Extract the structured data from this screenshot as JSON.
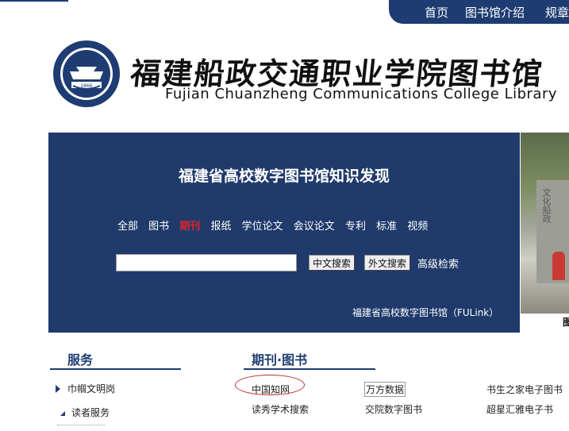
{
  "top_nav": {
    "items": [
      "首页",
      "图书馆介绍",
      "规章"
    ]
  },
  "header": {
    "logo_year": "1866",
    "title_cn": "福建船政交通职业学院图书馆",
    "title_en": "Fujian Chuanzheng Communications College Library"
  },
  "search_panel": {
    "title": "福建省高校数字图书馆知识发现",
    "categories": [
      "全部",
      "图书",
      "期刊",
      "报纸",
      "学位论文",
      "会议论文",
      "专利",
      "标准",
      "视频"
    ],
    "active_category": "期刊",
    "input_value": "",
    "cn_search_label": "中文搜索",
    "foreign_search_label": "外文搜索",
    "advanced_label": "高级检索",
    "footer": "福建省高校数字图书馆（FULink）"
  },
  "photo": {
    "stone_text": "文化船政",
    "caption": "图"
  },
  "services": {
    "title": "服务",
    "items": [
      "巾帼文明岗",
      "读者服务"
    ]
  },
  "journals": {
    "title": "期刊·图书",
    "rows": [
      [
        "中国知网",
        "万方数据",
        "书生之家电子图书"
      ],
      [
        "读秀学术搜索",
        "交院数字图书",
        "超星汇雅电子书"
      ]
    ]
  },
  "colors": {
    "navy": "#1f3c72",
    "panel": "#1f3a6b",
    "active": "#e0242a",
    "circle": "#c3282d"
  }
}
